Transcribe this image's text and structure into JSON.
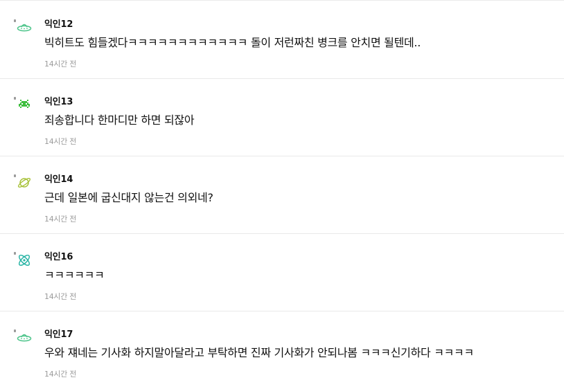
{
  "comments": [
    {
      "author": "익인12",
      "text": "빅히트도 힘들겠다ㅋㅋㅋㅋㅋㅋㅋㅋㅋㅋㅋㅋ 돌이 저런짜친 병크를 안치면 될텐데..",
      "time": "14시간 전",
      "icon": "ufo-icon",
      "icon_color": "#4cc48a"
    },
    {
      "author": "익인13",
      "text": "죄송합니다 한마디만 하면 되잖아",
      "time": "14시간 전",
      "icon": "space-invader-icon",
      "icon_color": "#3fbf3f"
    },
    {
      "author": "익인14",
      "text": "근데 일본에 굽신대지 않는건 의외네?",
      "time": "14시간 전",
      "icon": "planet-icon",
      "icon_color": "#a8c23a"
    },
    {
      "author": "익인16",
      "text": "ㅋㅋㅋㅋㅋㅋ",
      "time": "14시간 전",
      "icon": "atom-icon",
      "icon_color": "#2bb5a6"
    },
    {
      "author": "익인17",
      "text": "우와 쟤네는 기사화 하지말아달라고 부탁하면 진짜 기사화가 안되나봄 ㅋㅋㅋ신기하다 ㅋㅋㅋㅋ",
      "time": "14시간 전",
      "icon": "ufo-icon",
      "icon_color": "#4cc48a"
    }
  ]
}
